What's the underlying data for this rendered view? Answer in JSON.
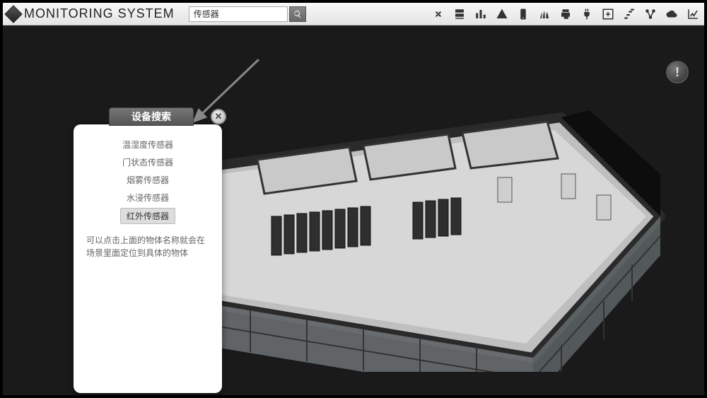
{
  "app": {
    "title": "MONITORING SYSTEM"
  },
  "search": {
    "value": "传感器"
  },
  "panel": {
    "title": "设备搜索",
    "close_glyph": "✕",
    "items": [
      "温湿度传感器",
      "门状态传感器",
      "烟雾传感器",
      "水浸传感器",
      "红外传感器"
    ],
    "selected_index": 4,
    "hint": "可以点击上面的物体名称就会在场景里面定位到具体的物体"
  },
  "alert": {
    "glyph": "!"
  },
  "toolbar_icons": [
    "fan-icon",
    "server-icon",
    "bar-chart-icon",
    "warning-icon",
    "mobile-icon",
    "grass-icon",
    "printer-icon",
    "plug-icon",
    "add-frame-icon",
    "steps-icon",
    "nodes-icon",
    "cloud-icon",
    "line-chart-icon"
  ]
}
